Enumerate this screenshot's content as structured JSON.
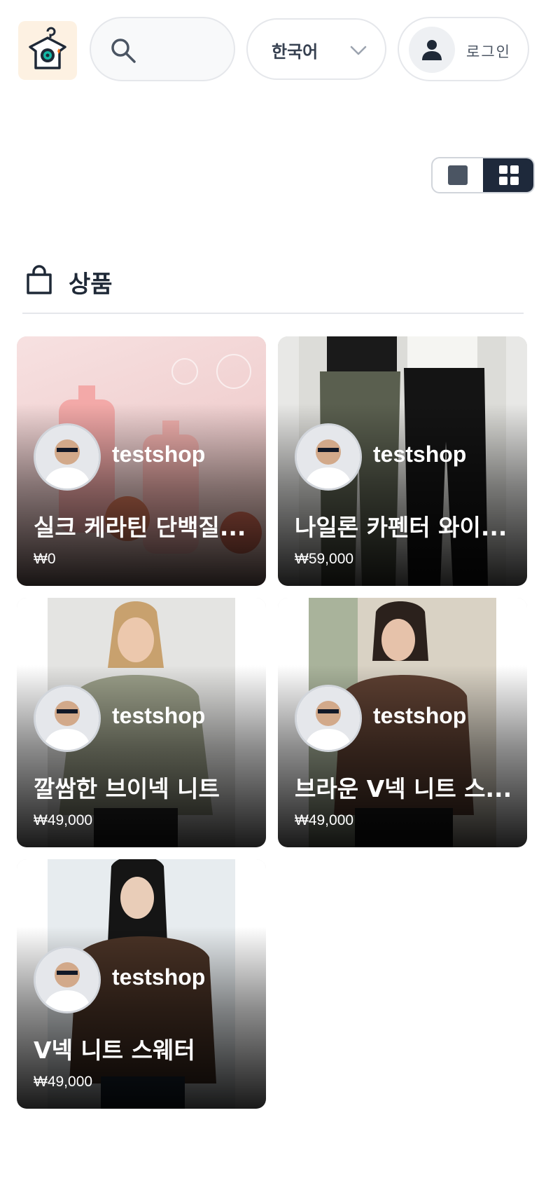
{
  "header": {
    "logo_icon": "hanger-camera-logo-icon",
    "search_icon": "search-icon",
    "search_placeholder": "",
    "language": "한국어",
    "language_icon": "chevron-down-icon",
    "login_icon": "user-icon",
    "login_label": "로그인"
  },
  "view_toggle": {
    "options": [
      "single-view",
      "grid-view"
    ],
    "selected": "grid-view"
  },
  "section": {
    "icon": "shopping-bag-icon",
    "title": "상품"
  },
  "products": [
    {
      "seller": "testshop",
      "name": "실크 케라틴 단백질...",
      "price": "₩0",
      "photo_tone": "#f1d6d6"
    },
    {
      "seller": "testshop",
      "name": "나일론 카펜터 와이...",
      "price": "₩59,000",
      "photo_tone": "#6f7364"
    },
    {
      "seller": "testshop",
      "name": "깔쌈한 브이넥 니트",
      "price": "₩49,000",
      "photo_tone": "#9aa08d"
    },
    {
      "seller": "testshop",
      "name": "브라운 V넥 니트 스...",
      "price": "₩49,000",
      "photo_tone": "#6b4a3a"
    },
    {
      "seller": "testshop",
      "name": "V넥 니트 스웨터",
      "price": "₩49,000",
      "photo_tone": "#4a3326"
    }
  ],
  "colors": {
    "accent_dark": "#1e293b",
    "border": "#e5e7eb",
    "text": "#1f2937"
  }
}
